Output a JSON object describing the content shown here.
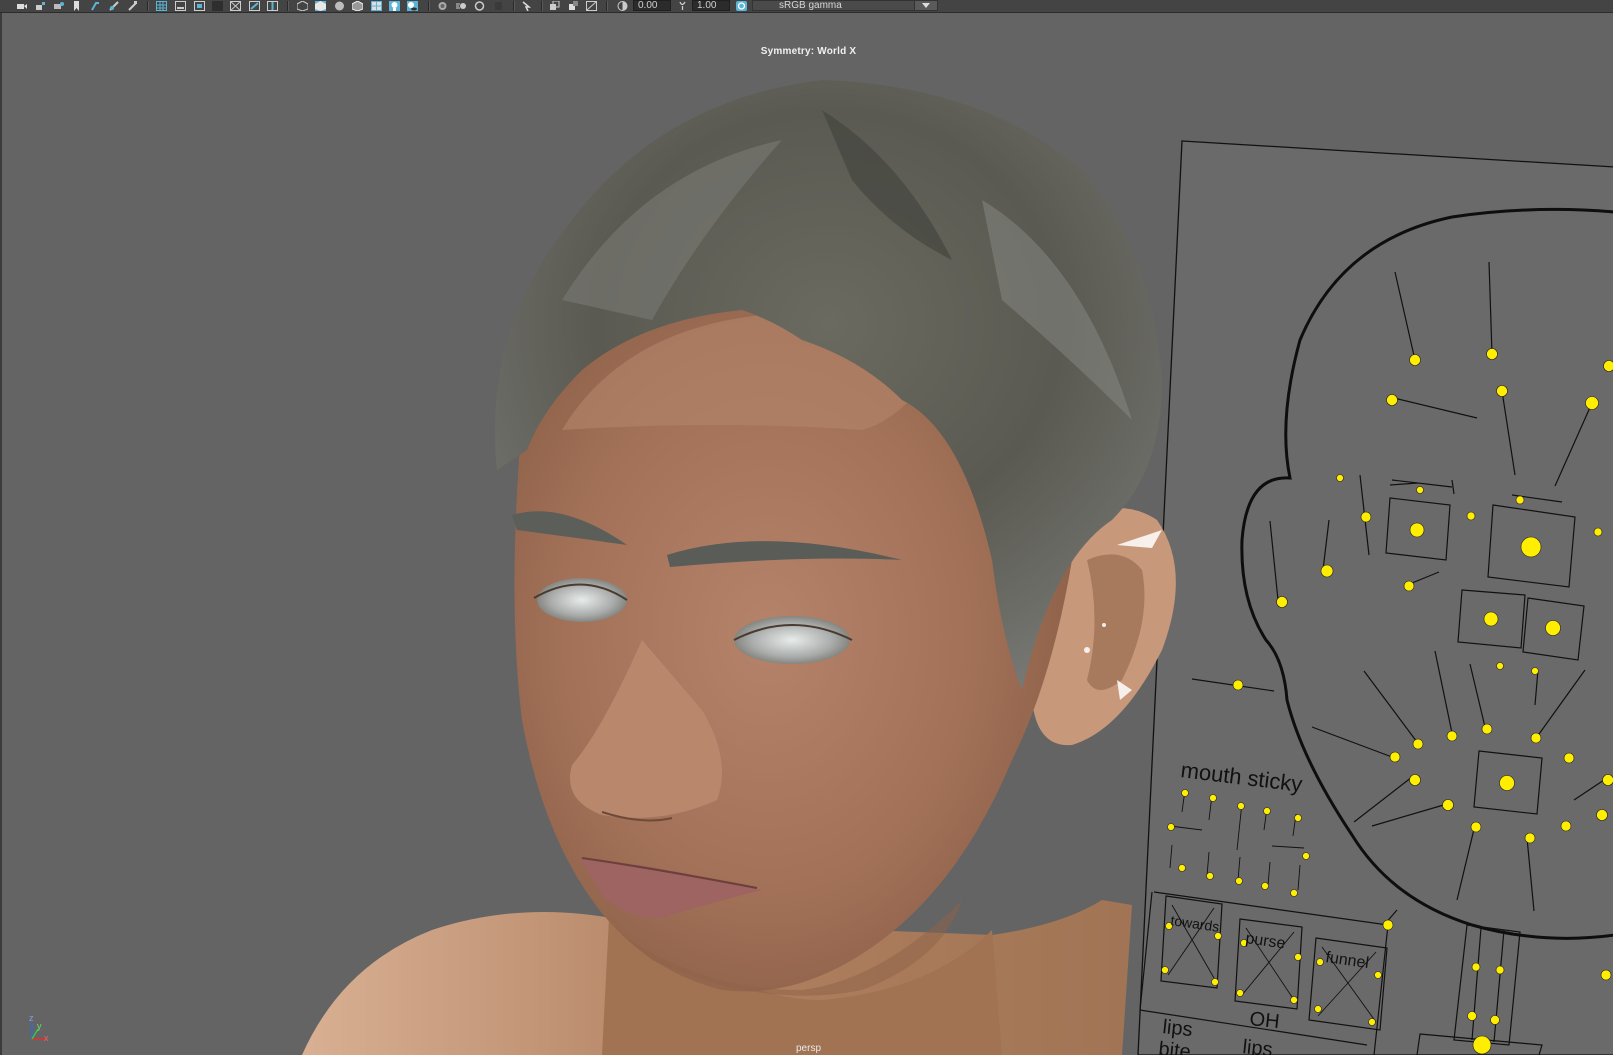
{
  "toolbar": {
    "exposure_value": "0.00",
    "gamma_value": "1.00",
    "color_space": "sRGB gamma"
  },
  "viewport": {
    "symmetry_label": "Symmetry: World X",
    "camera_name": "persp"
  },
  "face_rig": {
    "mouth_sticky_label": "mouth sticky",
    "towards_label": "towards",
    "purse_label": "purse",
    "funnel_label": "funnel",
    "oh_label": "OH",
    "lips_label": "lips",
    "bite_label": "bite",
    "lips2_label": "lips"
  },
  "axis": {
    "x": "x",
    "y": "y",
    "z": "z"
  },
  "colors": {
    "viewport_bg": "#646464",
    "toolbar_bg": "#444444",
    "control_yellow": "#ffee00",
    "active_icon": "#5ab5d6"
  }
}
